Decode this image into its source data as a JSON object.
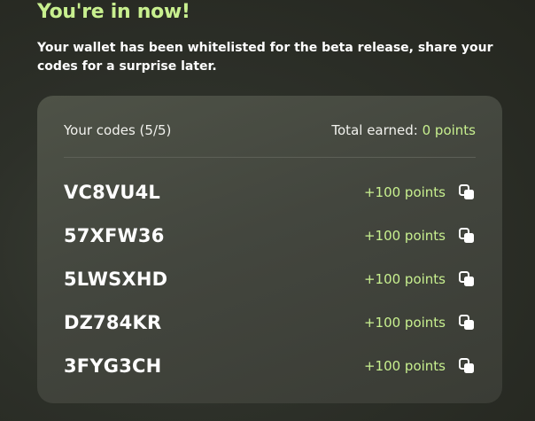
{
  "header": {
    "title": "You're in now!",
    "subtitle": "Your wallet has been whitelisted for the beta release, share your codes for a surprise later."
  },
  "card": {
    "codes_label": "Your codes (5/5)",
    "total_label": "Total earned:",
    "total_value": "0 points",
    "codes": [
      {
        "code": "VC8VU4L",
        "points": "+100 points",
        "icon": "copy-icon"
      },
      {
        "code": "57XFW36",
        "points": "+100 points",
        "icon": "copy-icon"
      },
      {
        "code": "5LWSXHD",
        "points": "+100 points",
        "icon": "copy-icon"
      },
      {
        "code": "DZ784KR",
        "points": "+100 points",
        "icon": "copy-icon"
      },
      {
        "code": "3FYG3CH",
        "points": "+100 points",
        "icon": "copy-icon"
      }
    ]
  },
  "colors": {
    "accent": "#c8f08f",
    "background": "#2d3029",
    "card": "#45483f"
  }
}
